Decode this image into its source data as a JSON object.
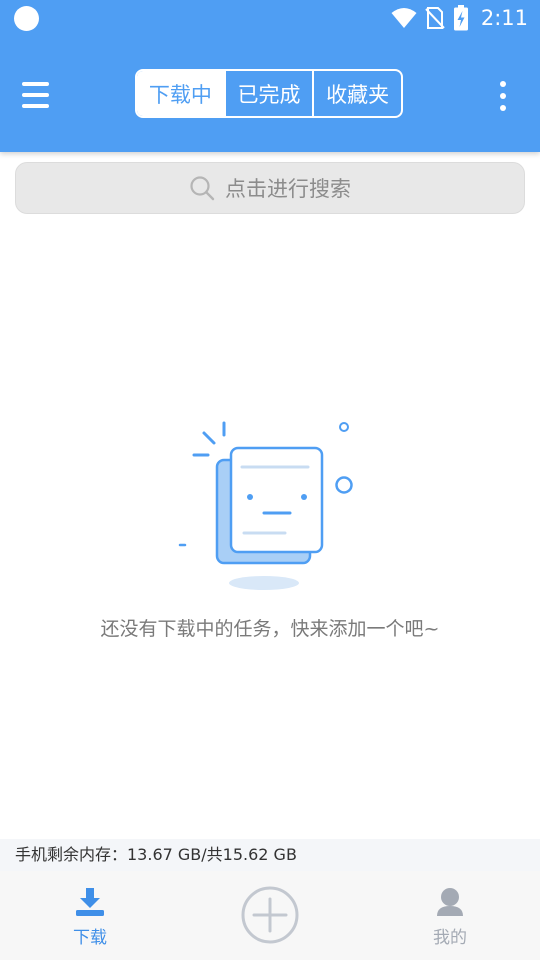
{
  "status_bar": {
    "time": "2:11",
    "icons": [
      "circle-indicator-icon",
      "wifi-icon",
      "no-sim-icon",
      "battery-charging-icon"
    ]
  },
  "toolbar": {
    "menu_icon": "menu-icon",
    "more_icon": "more-vertical-icon",
    "tabs": [
      {
        "label": "下载中",
        "active": true
      },
      {
        "label": "已完成",
        "active": false
      },
      {
        "label": "收藏夹",
        "active": false
      }
    ]
  },
  "search": {
    "placeholder": "点击进行搜索",
    "icon": "search-icon"
  },
  "empty_state": {
    "message": "还没有下载中的任务，快来添加一个吧~",
    "illustration": "empty-document-illustration"
  },
  "storage": {
    "text": "手机剩余内存：13.67 GB/共15.62 GB"
  },
  "bottom_nav": {
    "items": [
      {
        "label": "下载",
        "icon": "download-icon",
        "active": true
      },
      {
        "label": "我的",
        "icon": "user-icon",
        "active": false
      }
    ],
    "add_icon": "add-circle-icon"
  },
  "colors": {
    "primary": "#4f9ef3",
    "active_nav": "#3f8fe8",
    "inactive_nav": "#a4aab4",
    "search_bg": "#e8e8e8",
    "empty_text": "#7a7a7a"
  }
}
